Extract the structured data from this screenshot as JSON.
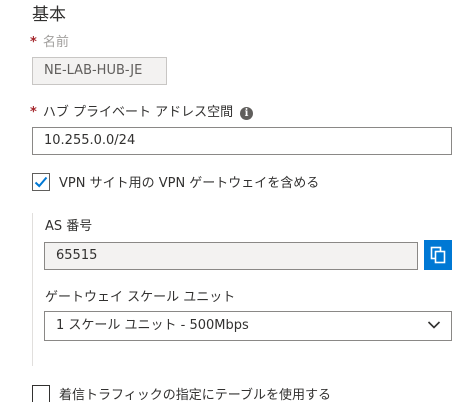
{
  "section": {
    "title": "基本"
  },
  "name_field": {
    "label": "名前",
    "value": "NE-LAB-HUB-JE",
    "required_mark": "*"
  },
  "address_space": {
    "label": "ハブ プライベート アドレス空間",
    "value": "10.255.0.0/24",
    "required_mark": "*",
    "info_icon_glyph": "i"
  },
  "vpn_gateway": {
    "label": "VPN サイト用の VPN ゲートウェイを含める",
    "checked": true
  },
  "as_number": {
    "label": "AS 番号",
    "value": "65515"
  },
  "scale_unit": {
    "label": "ゲートウェイ スケール ユニット",
    "selected": "1 スケール ユニット - 500Mbps"
  },
  "route_table": {
    "label": "着信トラフィックの指定にテーブルを使用する",
    "checked": false
  },
  "colors": {
    "accent": "#0078d4",
    "required": "#a4262c",
    "disabled_bg": "#f3f2f1"
  }
}
